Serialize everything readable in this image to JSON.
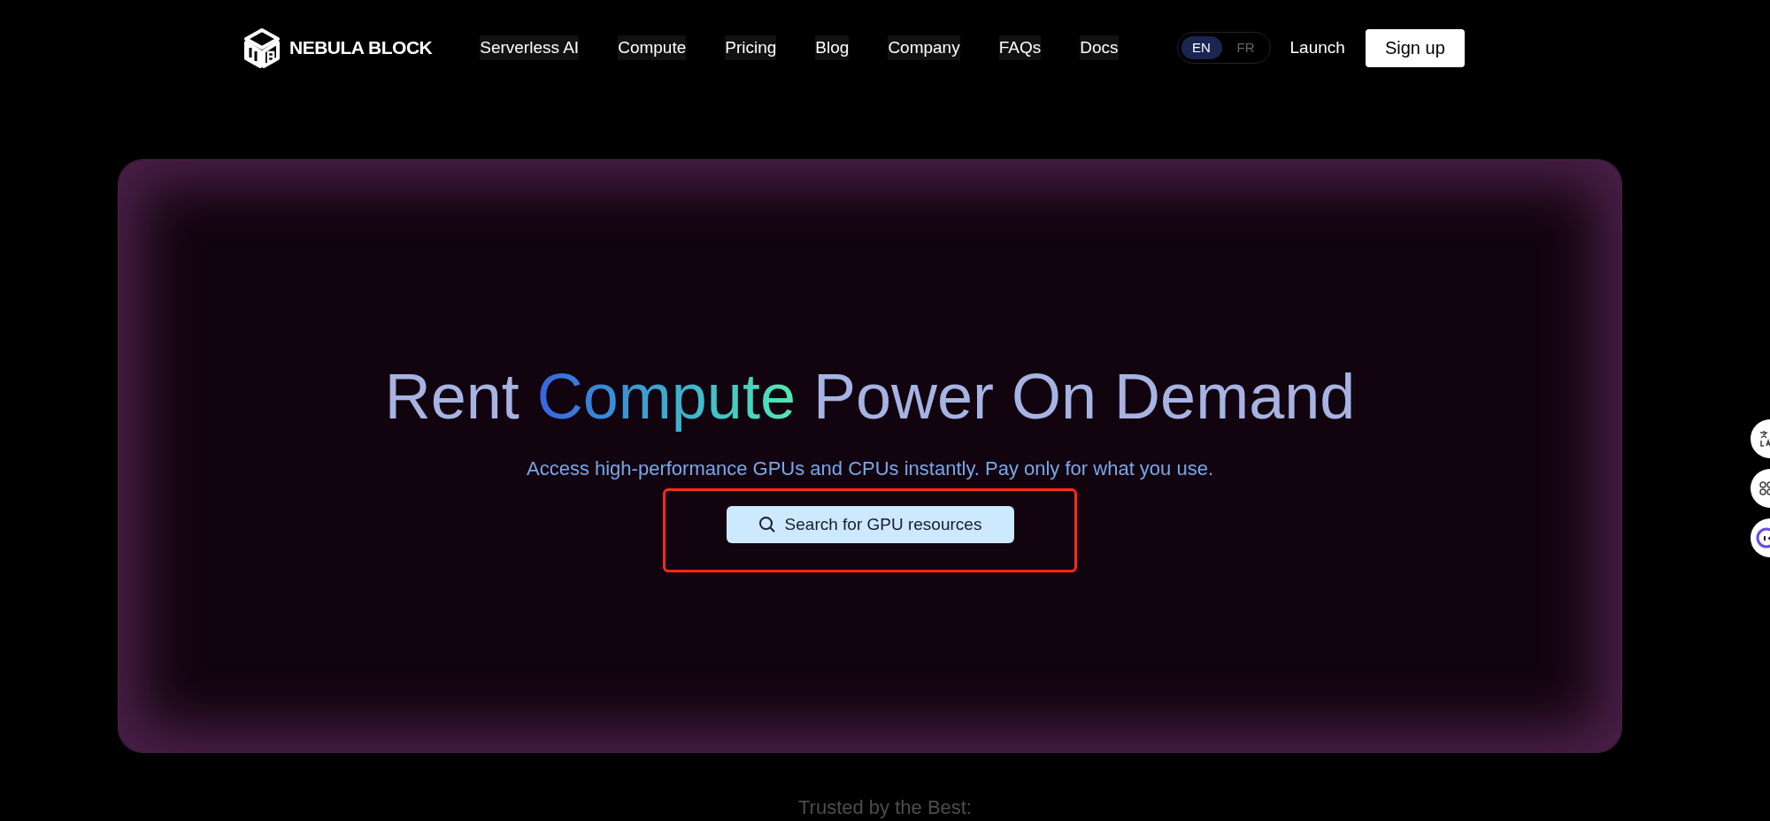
{
  "brand": {
    "name": "NEBULA BLOCK"
  },
  "nav": [
    {
      "label": "Serverless AI"
    },
    {
      "label": "Compute"
    },
    {
      "label": "Pricing"
    },
    {
      "label": "Blog"
    },
    {
      "label": "Company"
    },
    {
      "label": "FAQs"
    },
    {
      "label": "Docs"
    }
  ],
  "languages": [
    {
      "label": "EN",
      "selected": true
    },
    {
      "label": "FR",
      "selected": false
    }
  ],
  "launch": "Launch",
  "signup": "Sign up",
  "hero": {
    "heading": [
      {
        "text": "Rent ",
        "kind": "plain"
      },
      {
        "text": "Compute",
        "kind": "gradient"
      },
      {
        "text": " Power On Demand",
        "kind": "plain"
      }
    ],
    "subtitle": "Access high-performance GPUs and CPUs instantly. Pay only for what you use.",
    "search_button": "Search for GPU resources",
    "highlighted": true
  },
  "trusted": "Trusted by the Best:"
}
